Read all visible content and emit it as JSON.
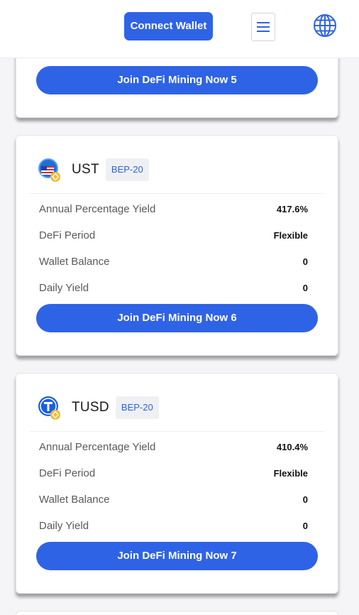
{
  "header": {
    "connect_label": "Connect Wallet",
    "menu_icon": "hamburger-menu-icon",
    "language_icon": "globe-icon"
  },
  "cards": [
    {
      "join_label": "Join DeFi Mining Now 5"
    },
    {
      "coin": "UST",
      "network": "BEP-20",
      "icon": "ust-flag-coin-icon",
      "rows": [
        {
          "label": "Annual Percentage Yield",
          "value": "417.6%"
        },
        {
          "label": "DeFi Period",
          "value": "Flexible"
        },
        {
          "label": "Wallet Balance",
          "value": "0"
        },
        {
          "label": "Daily Yield",
          "value": "0"
        }
      ],
      "join_label": "Join DeFi Mining Now 6"
    },
    {
      "coin": "TUSD",
      "network": "BEP-20",
      "icon": "tusd-coin-icon",
      "rows": [
        {
          "label": "Annual Percentage Yield",
          "value": "410.4%"
        },
        {
          "label": "DeFi Period",
          "value": "Flexible"
        },
        {
          "label": "Wallet Balance",
          "value": "0"
        },
        {
          "label": "Daily Yield",
          "value": "0"
        }
      ],
      "join_label": "Join DeFi Mining Now 7"
    }
  ],
  "colors": {
    "accent": "#2f63e6",
    "badge_text": "#3260d8",
    "badge_bg": "#eef0f4",
    "bnb_yellow": "#f3ba2f"
  }
}
